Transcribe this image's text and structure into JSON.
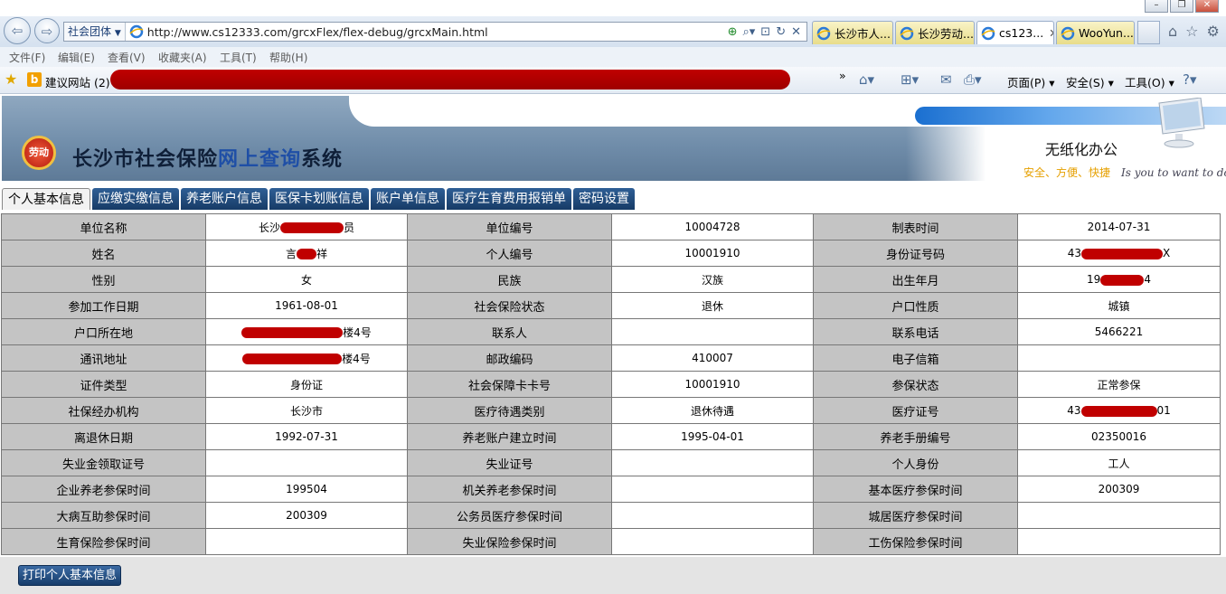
{
  "window": {
    "controls": [
      "–",
      "❐",
      "✕"
    ]
  },
  "address_bar": {
    "site_selector": "社会团体",
    "url": "http://www.cs12333.com/grcxFlex/flex-debug/grcxMain.html",
    "tabs": [
      {
        "label": "长沙市人..."
      },
      {
        "label": "长沙劳动..."
      },
      {
        "label": "cs123..."
      },
      {
        "label": "WooYun..."
      }
    ]
  },
  "menu": {
    "items": [
      "文件(F)",
      "编辑(E)",
      "查看(V)",
      "收藏夹(A)",
      "工具(T)",
      "帮助(H)"
    ]
  },
  "favorites": {
    "suggested": "建议网站 (2)",
    "more": "»"
  },
  "command_bar": {
    "page": "页面(P)",
    "safety": "安全(S)",
    "tools": "工具(O)"
  },
  "banner": {
    "logo_text": "劳动",
    "title_a": "长沙市社会保险",
    "title_b": "网上查询",
    "title_c": "系统",
    "paperless": "无纸化办公",
    "slogan_1": "安全、方便、快捷",
    "slogan_en": "Is you to want to do"
  },
  "module_tabs": [
    "个人基本信息",
    "应缴实缴信息",
    "养老账户信息",
    "医保卡划账信息",
    "账户单信息",
    "医疗生育费用报销单",
    "密码设置"
  ],
  "grid": [
    [
      [
        "单位名称",
        "长沙",
        "",
        "员"
      ],
      [
        "单位编号",
        "10004728"
      ],
      [
        "制表时间",
        "2014-07-31"
      ]
    ],
    [
      [
        "姓名",
        "言",
        "",
        "祥"
      ],
      [
        "个人编号",
        "10001910"
      ],
      [
        "身份证号码",
        "43",
        "",
        "X"
      ]
    ],
    [
      [
        "性别",
        "女"
      ],
      [
        "民族",
        "汉族"
      ],
      [
        "出生年月",
        "19",
        "",
        "4"
      ]
    ],
    [
      [
        "参加工作日期",
        "1961-08-01"
      ],
      [
        "社会保险状态",
        "退休"
      ],
      [
        "户口性质",
        "城镇"
      ]
    ],
    [
      [
        "户口所在地",
        "",
        "",
        "楼4号"
      ],
      [
        "联系人",
        ""
      ],
      [
        "联系电话",
        "5466221"
      ]
    ],
    [
      [
        "通讯地址",
        "",
        "",
        "楼4号"
      ],
      [
        "邮政编码",
        "410007"
      ],
      [
        "电子信箱",
        ""
      ]
    ],
    [
      [
        "证件类型",
        "身份证"
      ],
      [
        "社会保障卡卡号",
        "10001910"
      ],
      [
        "参保状态",
        "正常参保"
      ]
    ],
    [
      [
        "社保经办机构",
        "长沙市"
      ],
      [
        "医疗待遇类别",
        "退休待遇"
      ],
      [
        "医疗证号",
        "43",
        "",
        "01"
      ]
    ],
    [
      [
        "离退休日期",
        "1992-07-31"
      ],
      [
        "养老账户建立时间",
        "1995-04-01"
      ],
      [
        "养老手册编号",
        "02350016"
      ]
    ],
    [
      [
        "失业金领取证号",
        ""
      ],
      [
        "失业证号",
        ""
      ],
      [
        "个人身份",
        "工人"
      ]
    ],
    [
      [
        "企业养老参保时间",
        "199504"
      ],
      [
        "机关养老参保时间",
        ""
      ],
      [
        "基本医疗参保时间",
        "200309"
      ]
    ],
    [
      [
        "大病互助参保时间",
        "200309"
      ],
      [
        "公务员医疗参保时间",
        ""
      ],
      [
        "城居医疗参保时间",
        ""
      ]
    ],
    [
      [
        "生育保险参保时间",
        ""
      ],
      [
        "失业保险参保时间",
        ""
      ],
      [
        "工伤保险参保时间",
        ""
      ]
    ]
  ],
  "print_button": "打印个人基本信息"
}
